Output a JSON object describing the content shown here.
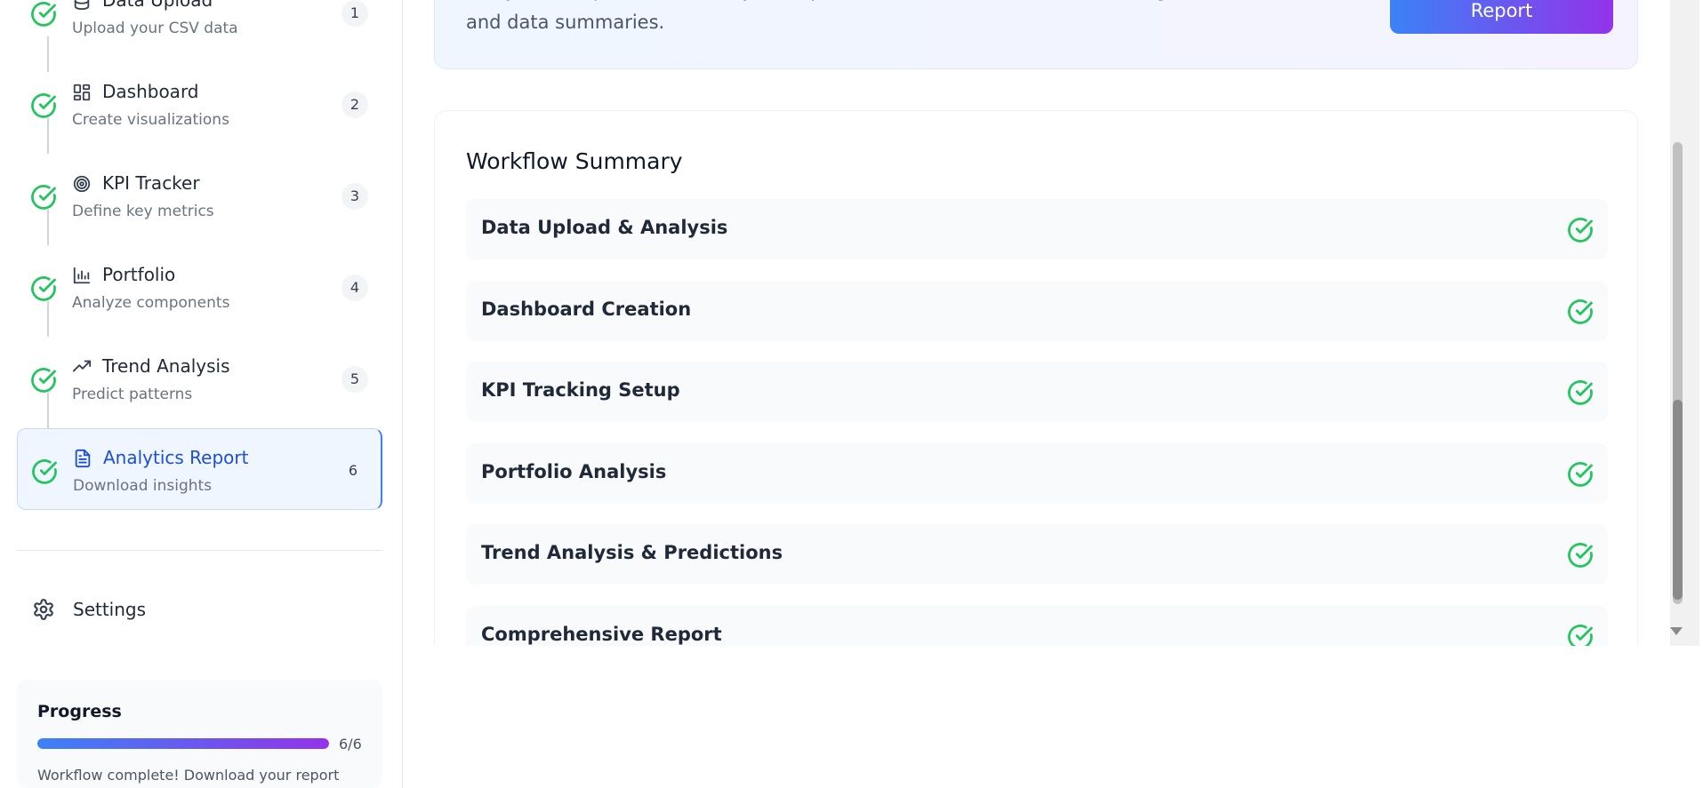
{
  "sidebar": {
    "steps": [
      {
        "title": "Data Upload",
        "subtitle": "Upload your CSV data",
        "number": "1",
        "icon": "database-icon"
      },
      {
        "title": "Dashboard",
        "subtitle": "Create visualizations",
        "number": "2",
        "icon": "dashboard-grid-icon"
      },
      {
        "title": "KPI Tracker",
        "subtitle": "Define key metrics",
        "number": "3",
        "icon": "target-icon"
      },
      {
        "title": "Portfolio",
        "subtitle": "Analyze components",
        "number": "4",
        "icon": "bar-chart-icon"
      },
      {
        "title": "Trend Analysis",
        "subtitle": "Predict patterns",
        "number": "5",
        "icon": "trending-up-icon"
      },
      {
        "title": "Analytics Report",
        "subtitle": "Download insights",
        "number": "6",
        "icon": "document-icon"
      }
    ],
    "settings_label": "Settings",
    "progress": {
      "title": "Progress",
      "count": "6/6",
      "fraction": 1.0,
      "message": "Workflow complete! Download your report"
    }
  },
  "main": {
    "banner": {
      "description": "Get your comprehensive analytics report in markdown format with all insights, recommendations, and data summaries.",
      "button_label": "Report"
    },
    "summary": {
      "title": "Workflow Summary",
      "items": [
        "Data Upload & Analysis",
        "Dashboard Creation",
        "KPI Tracking Setup",
        "Portfolio Analysis",
        "Trend Analysis & Predictions",
        "Comprehensive Report"
      ]
    }
  },
  "colors": {
    "success": "#22c55e",
    "accent": "#3b82f6",
    "accent_end": "#9333ea",
    "active_text": "#1d4ed8"
  }
}
